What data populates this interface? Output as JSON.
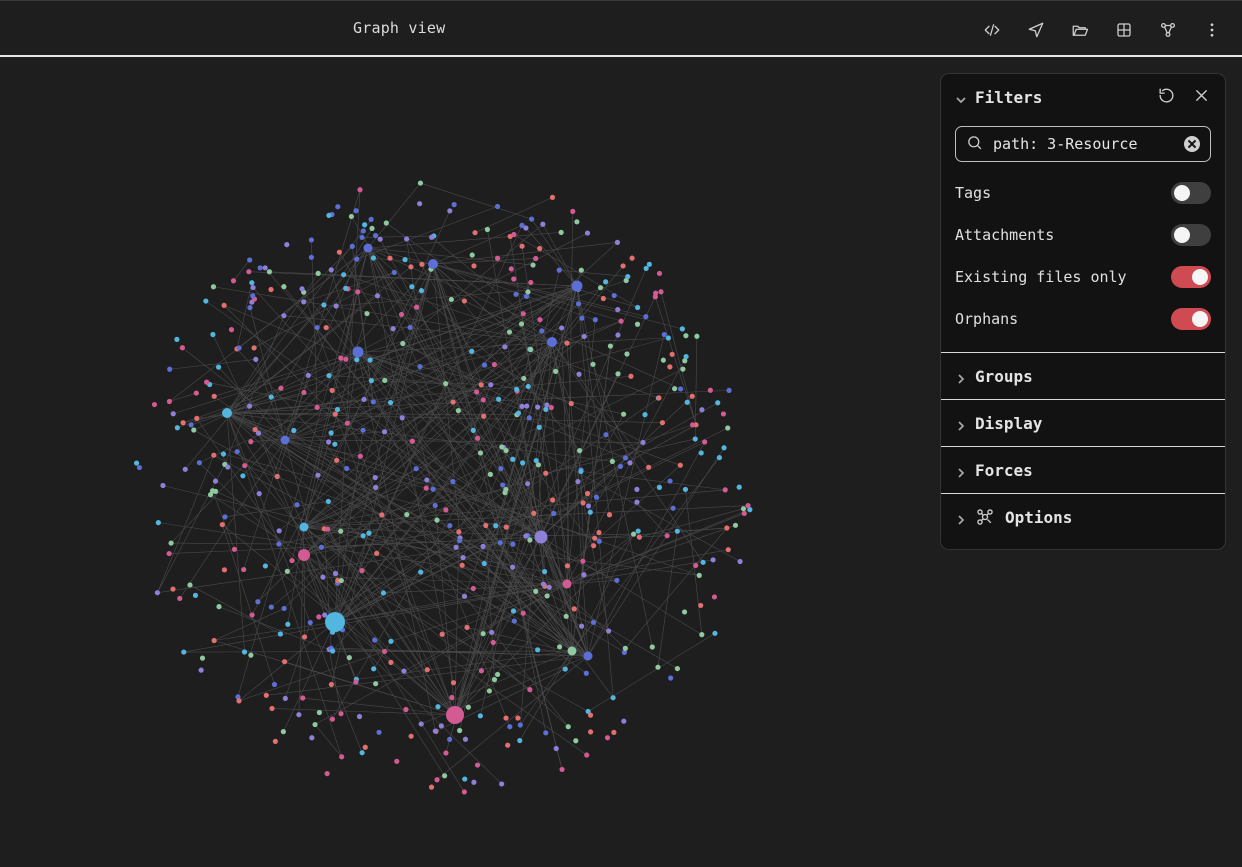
{
  "header": {
    "title": "Graph view",
    "toolbar_icons": [
      "code-icon",
      "navigate-icon",
      "folder-icon",
      "grid-icon",
      "graph-icon",
      "more-icon"
    ]
  },
  "filters_panel": {
    "title": "Filters",
    "search": {
      "value": "path: 3-Resource",
      "placeholder": "Search files..."
    },
    "toggles": [
      {
        "label": "Tags",
        "on": false
      },
      {
        "label": "Attachments",
        "on": false
      },
      {
        "label": "Existing files only",
        "on": true
      },
      {
        "label": "Orphans",
        "on": true
      }
    ],
    "sections": [
      {
        "label": "Groups"
      },
      {
        "label": "Display"
      },
      {
        "label": "Forces"
      },
      {
        "label": "Options"
      }
    ]
  },
  "colors": {
    "background": "#1e1e1e",
    "toggle_on": "#d04a52",
    "node_colors": [
      "#5b6fd6",
      "#52b6e0",
      "#8e7fd8",
      "#e46f6f",
      "#8fc9a0",
      "#d35a92"
    ]
  }
}
